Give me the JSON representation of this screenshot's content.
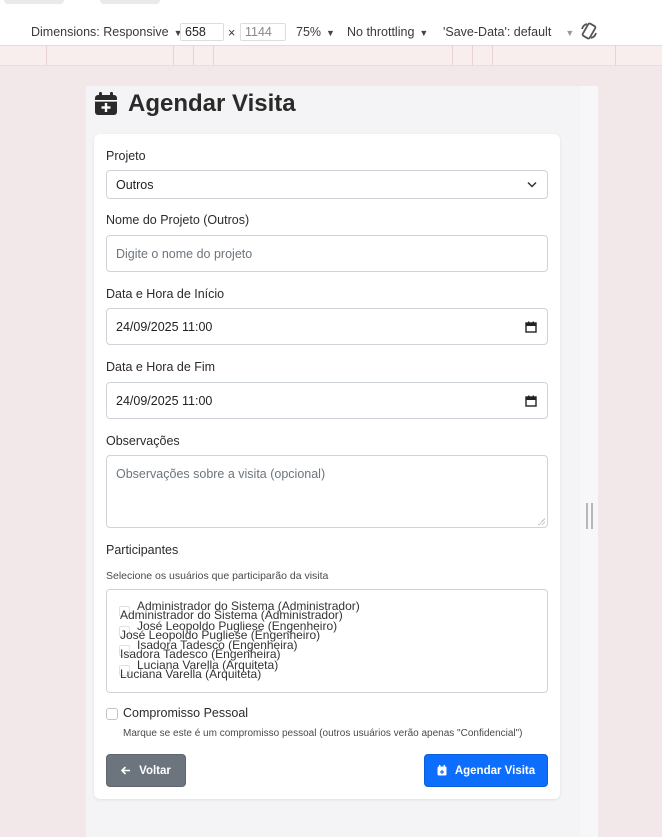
{
  "devtools": {
    "dimensions_label": "Dimensions: Responsive",
    "width_value": "658",
    "times": "×",
    "height_placeholder": "1144",
    "zoom": "75%",
    "throttling": "No throttling",
    "save_data": "'Save-Data': default"
  },
  "page": {
    "title": "Agendar Visita"
  },
  "form": {
    "project_label": "Projeto",
    "project_value": "Outros",
    "project_name_label": "Nome do Projeto (Outros)",
    "project_name_placeholder": "Digite o nome do projeto",
    "start_label": "Data e Hora de Início",
    "start_value": "24/09/2025 11:00",
    "end_label": "Data e Hora de Fim",
    "end_value": "24/09/2025 11:00",
    "notes_label": "Observações",
    "notes_placeholder": "Observações sobre a visita (opcional)",
    "participants_label": "Participantes",
    "participants_help": "Selecione os usuários que participarão da visita",
    "participants": [
      {
        "a": "Administrador do Sistema (Administrador)",
        "b": "Administrador do Sistema (Administrador)"
      },
      {
        "a": "José Leopoldo Pugliese (Engenheiro)",
        "b": "José Leopoldo Pugliese (Engenheiro)"
      },
      {
        "a": "Isadora Tadesco (Engenheira)",
        "b": "Isadora Tadesco (Engenheira)"
      },
      {
        "a": "Luciana Varella (Arquiteta)",
        "b": "Luciana Varella (Arquiteta)"
      }
    ],
    "personal_label": "Compromisso Pessoal",
    "personal_help": "Marque se este é um compromisso pessoal (outros usuários verão apenas \"Confidencial\")",
    "back_label": "Voltar",
    "submit_label": "Agendar Visita"
  }
}
